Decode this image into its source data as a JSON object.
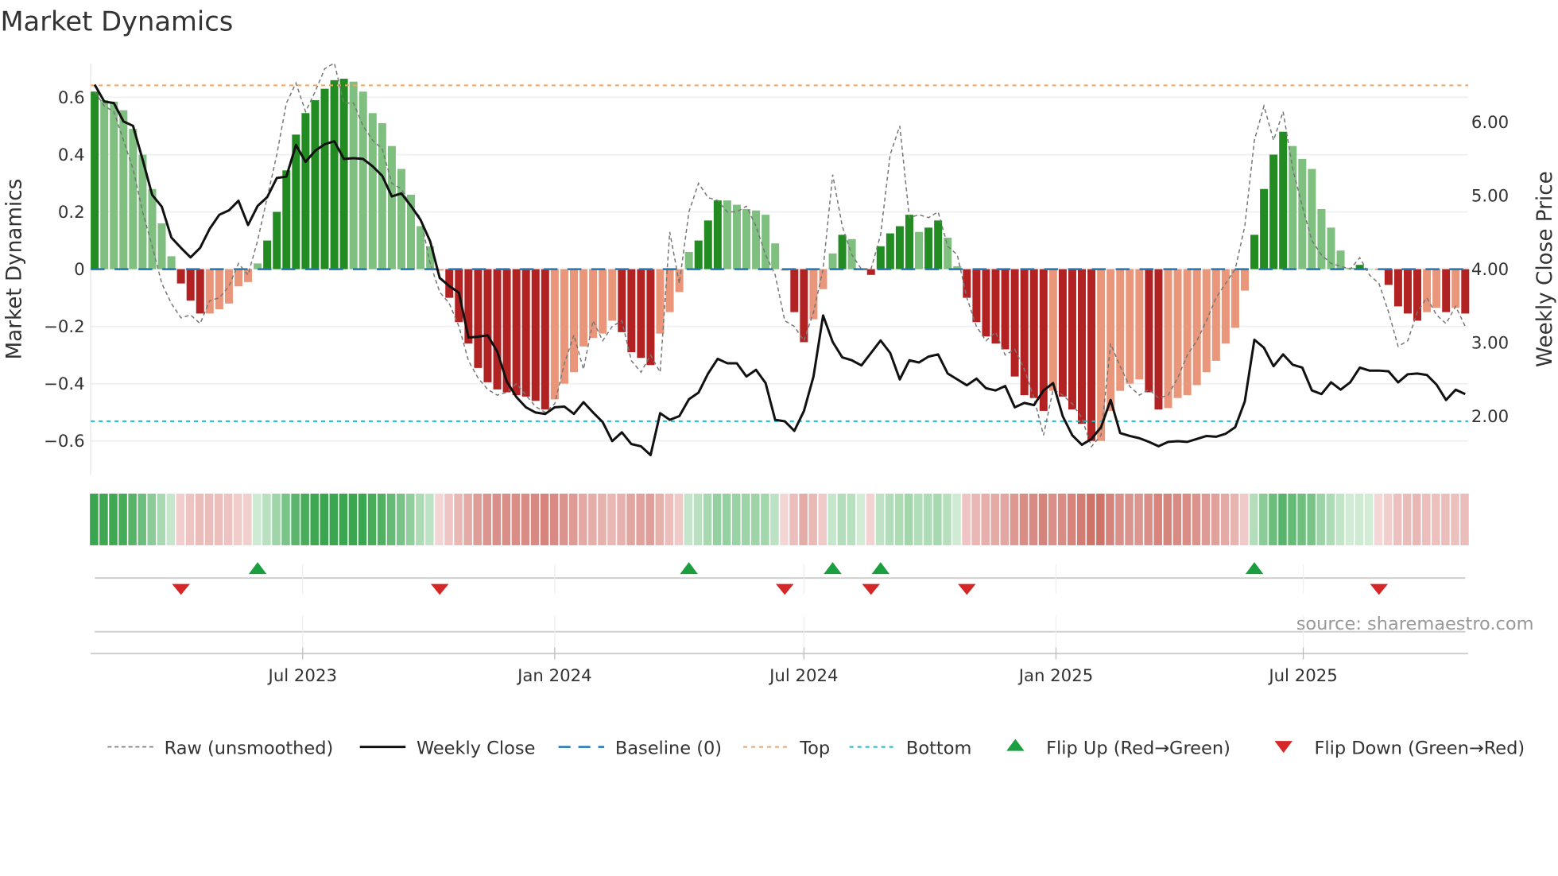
{
  "title": "Market Dynamics",
  "source": "source: sharemaestro.com",
  "chart_data": {
    "type": "bar",
    "title": "Market Dynamics",
    "ylabel": "Market Dynamics",
    "y2label": "Weekly Close Price",
    "ylim": [
      -0.72,
      0.72
    ],
    "y2lim": [
      1.2,
      6.8
    ],
    "yticks": [
      {
        "v": 0.6,
        "label": "0.6"
      },
      {
        "v": 0.4,
        "label": "0.4"
      },
      {
        "v": 0.2,
        "label": "0.2"
      },
      {
        "v": 0,
        "label": "0"
      },
      {
        "v": -0.2,
        "label": "−0.2"
      },
      {
        "v": -0.4,
        "label": "−0.4"
      },
      {
        "v": -0.6,
        "label": "−0.6"
      }
    ],
    "y2ticks": [
      {
        "v": 6,
        "label": "6.00"
      },
      {
        "v": 5,
        "label": "5.00"
      },
      {
        "v": 4,
        "label": "4.00"
      },
      {
        "v": 3,
        "label": "3.00"
      },
      {
        "v": 2,
        "label": "2.00"
      }
    ],
    "xticks": [
      {
        "week": 21.7,
        "label": "Jul 2023"
      },
      {
        "week": 48,
        "label": "Jan 2024"
      },
      {
        "week": 74,
        "label": "Jul 2024"
      },
      {
        "week": 100.3,
        "label": "Jan 2025"
      },
      {
        "week": 126.1,
        "label": "Jul 2025"
      }
    ],
    "top_level": 0.642,
    "bottom_level": -0.531,
    "baseline": 0,
    "dynamics": [
      0.62,
      0.59,
      0.585,
      0.555,
      0.49,
      0.4,
      0.28,
      0.16,
      0.045,
      -0.05,
      -0.11,
      -0.155,
      -0.155,
      -0.14,
      -0.12,
      -0.06,
      -0.045,
      0.02,
      0.1,
      0.2,
      0.345,
      0.47,
      0.545,
      0.59,
      0.63,
      0.66,
      0.665,
      0.655,
      0.62,
      0.545,
      0.51,
      0.43,
      0.35,
      0.26,
      0.15,
      0.08,
      -0.005,
      -0.1,
      -0.185,
      -0.26,
      -0.345,
      -0.395,
      -0.42,
      -0.43,
      -0.44,
      -0.445,
      -0.46,
      -0.49,
      -0.455,
      -0.4,
      -0.36,
      -0.27,
      -0.24,
      -0.225,
      -0.18,
      -0.22,
      -0.29,
      -0.31,
      -0.335,
      -0.225,
      -0.15,
      -0.08,
      0.06,
      0.1,
      0.17,
      0.24,
      0.24,
      0.225,
      0.21,
      0.205,
      0.19,
      0.09,
      -0.005,
      -0.15,
      -0.255,
      -0.175,
      -0.07,
      0.055,
      0.12,
      0.105,
      0.0,
      -0.02,
      0.08,
      0.125,
      0.15,
      0.19,
      0.13,
      0.145,
      0.17,
      0.11,
      0.01,
      -0.1,
      -0.185,
      -0.235,
      -0.26,
      -0.28,
      -0.375,
      -0.44,
      -0.45,
      -0.495,
      -0.425,
      -0.445,
      -0.49,
      -0.54,
      -0.6,
      -0.6,
      -0.495,
      -0.425,
      -0.4,
      -0.385,
      -0.43,
      -0.49,
      -0.485,
      -0.45,
      -0.44,
      -0.405,
      -0.36,
      -0.32,
      -0.26,
      -0.205,
      -0.075,
      0.12,
      0.28,
      0.4,
      0.48,
      0.43,
      0.385,
      0.35,
      0.21,
      0.145,
      0.065,
      0.005,
      0.015,
      0.0,
      -0.002,
      -0.055,
      -0.13,
      -0.155,
      -0.18,
      -0.15,
      -0.135,
      -0.15,
      -0.135,
      -0.155
    ],
    "raw": [
      0.62,
      0.57,
      0.55,
      0.45,
      0.35,
      0.2,
      0.08,
      -0.05,
      -0.12,
      -0.17,
      -0.16,
      -0.19,
      -0.11,
      -0.1,
      -0.06,
      0.02,
      -0.02,
      0.1,
      0.25,
      0.4,
      0.58,
      0.65,
      0.55,
      0.62,
      0.7,
      0.72,
      0.58,
      0.58,
      0.5,
      0.45,
      0.42,
      0.3,
      0.28,
      0.22,
      0.18,
      0.02,
      -0.08,
      -0.12,
      -0.2,
      -0.32,
      -0.38,
      -0.42,
      -0.44,
      -0.43,
      -0.4,
      -0.44,
      -0.48,
      -0.5,
      -0.47,
      -0.33,
      -0.23,
      -0.35,
      -0.18,
      -0.25,
      -0.2,
      -0.18,
      -0.32,
      -0.36,
      -0.3,
      -0.36,
      0.13,
      -0.05,
      0.2,
      0.3,
      0.25,
      0.24,
      0.2,
      0.2,
      0.22,
      0.15,
      0.05,
      -0.02,
      -0.18,
      -0.2,
      -0.25,
      -0.15,
      0.0,
      0.33,
      0.15,
      0.05,
      0.0,
      0.0,
      0.12,
      0.4,
      0.5,
      0.18,
      0.19,
      0.18,
      0.2,
      0.08,
      0.05,
      -0.1,
      -0.2,
      -0.25,
      -0.22,
      -0.3,
      -0.28,
      -0.35,
      -0.45,
      -0.58,
      -0.42,
      -0.44,
      -0.47,
      -0.52,
      -0.62,
      -0.58,
      -0.26,
      -0.34,
      -0.41,
      -0.44,
      -0.42,
      -0.45,
      -0.44,
      -0.38,
      -0.3,
      -0.25,
      -0.18,
      -0.1,
      -0.05,
      0.0,
      0.15,
      0.45,
      0.57,
      0.45,
      0.55,
      0.35,
      0.22,
      0.1,
      0.05,
      0.02,
      0.01,
      0.0,
      0.04,
      -0.02,
      -0.05,
      -0.15,
      -0.27,
      -0.25,
      -0.15,
      -0.1,
      -0.16,
      -0.19,
      -0.13,
      -0.2
    ],
    "weekly_close": [
      6.51,
      6.28,
      6.26,
      6.01,
      5.95,
      5.49,
      5.01,
      4.85,
      4.43,
      4.29,
      4.16,
      4.29,
      4.55,
      4.74,
      4.8,
      4.93,
      4.6,
      4.86,
      4.98,
      5.24,
      5.26,
      5.69,
      5.46,
      5.61,
      5.7,
      5.74,
      5.5,
      5.51,
      5.5,
      5.4,
      5.27,
      4.99,
      5.03,
      4.86,
      4.67,
      4.38,
      3.88,
      3.77,
      3.68,
      3.07,
      3.08,
      3.1,
      2.88,
      2.47,
      2.26,
      2.12,
      2.05,
      2.03,
      2.12,
      2.13,
      2.03,
      2.19,
      2.05,
      1.92,
      1.66,
      1.78,
      1.62,
      1.59,
      1.47,
      2.04,
      1.95,
      2.0,
      2.23,
      2.32,
      2.58,
      2.78,
      2.72,
      2.72,
      2.54,
      2.63,
      2.45,
      1.95,
      1.93,
      1.8,
      2.07,
      2.54,
      3.37,
      3.01,
      2.8,
      2.76,
      2.69,
      2.86,
      3.03,
      2.86,
      2.5,
      2.76,
      2.73,
      2.81,
      2.84,
      2.58,
      2.5,
      2.42,
      2.51,
      2.38,
      2.35,
      2.41,
      2.12,
      2.18,
      2.15,
      2.35,
      2.45,
      2.0,
      1.74,
      1.61,
      1.69,
      1.85,
      2.22,
      1.77,
      1.73,
      1.7,
      1.65,
      1.59,
      1.65,
      1.66,
      1.65,
      1.69,
      1.73,
      1.72,
      1.76,
      1.85,
      2.2,
      3.04,
      2.93,
      2.68,
      2.84,
      2.7,
      2.66,
      2.35,
      2.3,
      2.46,
      2.36,
      2.46,
      2.66,
      2.62,
      2.62,
      2.61,
      2.46,
      2.57,
      2.58,
      2.56,
      2.43,
      2.22,
      2.36,
      2.3
    ],
    "flip_up": [
      17,
      62,
      77,
      82,
      121
    ],
    "flip_down": [
      9,
      36,
      72,
      81,
      91,
      134
    ],
    "colors": {
      "up_strong": "#228b22",
      "up_weak": "#7fbf7f",
      "down_strong": "#b22222",
      "down_weak": "#e9967a",
      "baseline": "#1f77b4",
      "top": "#f4a460",
      "bottom": "#17becf",
      "close": "#111111",
      "raw": "#777777",
      "flip_up": "#1a9e3f",
      "flip_down": "#d62728"
    },
    "legend": [
      {
        "key": "raw",
        "label": "Raw (unsmoothed)"
      },
      {
        "key": "close",
        "label": "Weekly Close"
      },
      {
        "key": "baseline",
        "label": "Baseline (0)"
      },
      {
        "key": "top",
        "label": "Top"
      },
      {
        "key": "bottom",
        "label": "Bottom"
      },
      {
        "key": "flip_up",
        "label": "Flip Up (Red→Green)"
      },
      {
        "key": "flip_down",
        "label": "Flip Down (Green→Red)"
      }
    ]
  }
}
